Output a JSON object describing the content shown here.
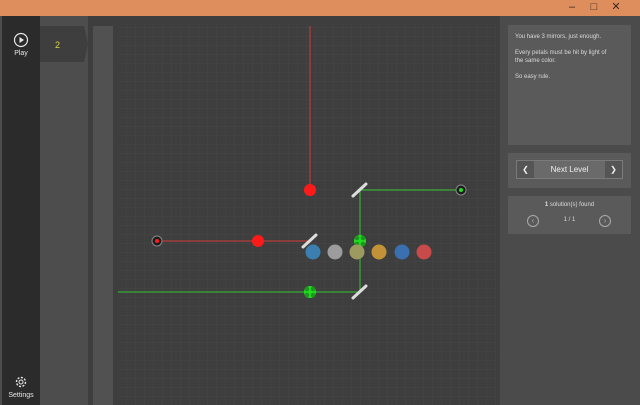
{
  "window": {
    "minimize": "–",
    "maximize": "□",
    "close": "✕"
  },
  "sidebar": {
    "play_label": "Play",
    "settings_label": "Settings"
  },
  "level": {
    "number": "2"
  },
  "hints": {
    "line1": "You have 3 mirrors, just enough.",
    "line2": "Every petals must be hit by light of",
    "line3": "the same color.",
    "line4": "So easy rule."
  },
  "navigation": {
    "next_level": "Next Level",
    "prev_arrow": "❮",
    "next_arrow": "❯"
  },
  "solutions": {
    "count": "1",
    "found_text": " solution(s) found",
    "page": "1 / 1",
    "prev": "‹",
    "next": "›"
  },
  "colors": {
    "red": "#ff1a1a",
    "green": "#22dd22",
    "beam_red": "#d23b3b",
    "beam_green": "#35c535",
    "palette": [
      "#3a7fb0",
      "#9c9c9c",
      "#9c9a5e",
      "#c29238",
      "#3a6fb0",
      "#c84a4a"
    ]
  }
}
